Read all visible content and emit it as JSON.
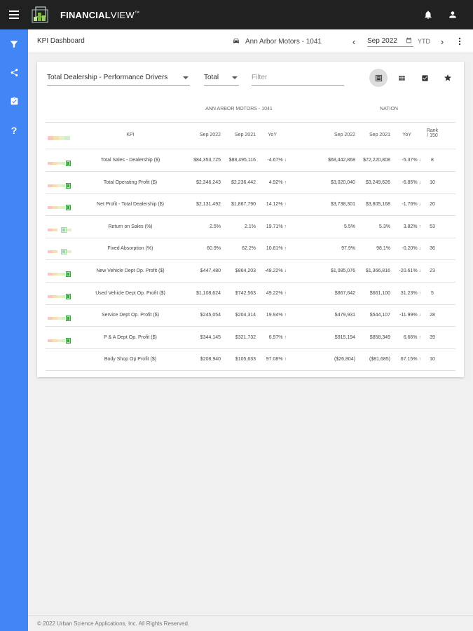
{
  "app": {
    "brand_bold": "FINANCIAL",
    "brand_light": "VIEW",
    "brand_tm": "™"
  },
  "header": {
    "page_title": "KPI Dashboard",
    "dealer": "Ann Arbor Motors - 1041",
    "period": "Sep 2022",
    "period_mode": "YTD"
  },
  "toolbar": {
    "report_select": "Total Dealership - Performance Drivers",
    "scope_select": "Total",
    "filter_placeholder": "Filter"
  },
  "table": {
    "group_dealer": "ANN ARBOR MOTORS - 1041",
    "group_nation": "NATION",
    "col_kpi": "KPI",
    "col_cur": "Sep 2022",
    "col_prev": "Sep 2021",
    "col_yoy": "YoY",
    "col_rank1": "Rank",
    "col_rank2": "/ 150",
    "rows": [
      {
        "kpi": "Total Sales - Dealership ($)",
        "d_cur": "$84,353,725",
        "d_prev": "$88,495,116",
        "d_yoy": "-4.67%",
        "d_dir": "down",
        "n_cur": "$68,442,868",
        "n_prev": "$72,220,808",
        "n_yoy": "-5.37%",
        "n_dir": "down",
        "rank": "8",
        "meter": "high"
      },
      {
        "kpi": "Total Operating Profit ($)",
        "d_cur": "$2,346,243",
        "d_prev": "$2,236,442",
        "d_yoy": "4.92%",
        "d_dir": "up",
        "n_cur": "$3,020,040",
        "n_prev": "$3,249,626",
        "n_yoy": "-6.85%",
        "n_dir": "down",
        "rank": "10",
        "meter": "high"
      },
      {
        "kpi": "Net Profit - Total Dealership ($)",
        "d_cur": "$2,131,492",
        "d_prev": "$1,867,790",
        "d_yoy": "14.12%",
        "d_dir": "up",
        "n_cur": "$3,738,301",
        "n_prev": "$3,805,168",
        "n_yoy": "-1.76%",
        "n_dir": "down",
        "rank": "20",
        "meter": "high"
      },
      {
        "kpi": "Return on Sales (%)",
        "d_cur": "2.5%",
        "d_prev": "2.1%",
        "d_yoy": "19.71%",
        "d_dir": "up",
        "n_cur": "5.5%",
        "n_prev": "5.3%",
        "n_yoy": "3.82%",
        "n_dir": "up",
        "rank": "53",
        "meter": "mid"
      },
      {
        "kpi": "Fixed Absorption (%)",
        "d_cur": "60.9%",
        "d_prev": "62.2%",
        "d_yoy": "10.81%",
        "d_dir": "up",
        "n_cur": "97.9%",
        "n_prev": "98.1%",
        "n_yoy": "-0.20%",
        "n_dir": "down",
        "rank": "36",
        "meter": "mid"
      },
      {
        "kpi": "New Vehicle Dept Op. Profit ($)",
        "d_cur": "$447,480",
        "d_prev": "$864,203",
        "d_yoy": "-48.22%",
        "d_dir": "down",
        "n_cur": "$1,085,076",
        "n_prev": "$1,366,816",
        "n_yoy": "-20.61%",
        "n_dir": "down",
        "rank": "23",
        "meter": "high"
      },
      {
        "kpi": "Used Vehicle Dept Op. Profit ($)",
        "d_cur": "$1,108,624",
        "d_prev": "$742,563",
        "d_yoy": "49.22%",
        "d_dir": "up",
        "n_cur": "$867,642",
        "n_prev": "$661,100",
        "n_yoy": "31.23%",
        "n_dir": "up",
        "rank": "5",
        "meter": "high"
      },
      {
        "kpi": "Service Dept Op. Profit ($)",
        "d_cur": "$245,054",
        "d_prev": "$204,314",
        "d_yoy": "19.94%",
        "d_dir": "up",
        "n_cur": "$479,931",
        "n_prev": "$544,107",
        "n_yoy": "-11.99%",
        "n_dir": "down",
        "rank": "28",
        "meter": "high"
      },
      {
        "kpi": "P & A Dept Op. Profit ($)",
        "d_cur": "$344,145",
        "d_prev": "$321,732",
        "d_yoy": "6.97%",
        "d_dir": "up",
        "n_cur": "$915,194",
        "n_prev": "$858,349",
        "n_yoy": "6.66%",
        "n_dir": "up",
        "rank": "39",
        "meter": "high"
      },
      {
        "kpi": "Body Shop Op Profit ($)",
        "d_cur": "$208,940",
        "d_prev": "$105,633",
        "d_yoy": "97.08%",
        "d_dir": "up",
        "n_cur": "($26,804)",
        "n_prev": "($81,685)",
        "n_yoy": "67.15%",
        "n_dir": "up",
        "rank": "10",
        "meter": "none"
      }
    ]
  },
  "footer": {
    "copyright": "© 2022 Urban Science Applications, Inc. All Rights Reserved."
  },
  "colors": {
    "topbar": "#212121",
    "sidebar": "#4285f4",
    "up": "#43a047",
    "down": "#e53935"
  }
}
